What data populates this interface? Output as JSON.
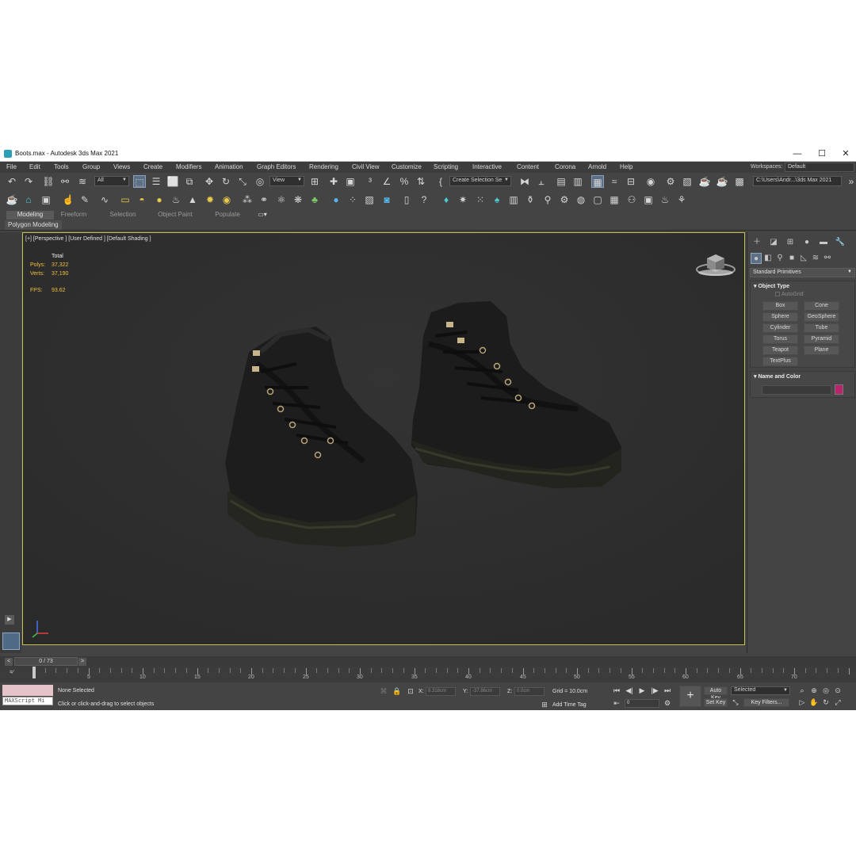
{
  "window": {
    "title": "Boots.max - Autodesk 3ds Max 2021",
    "minimize": "—",
    "maximize": "☐",
    "close": "✕"
  },
  "menu": [
    "File",
    "Edit",
    "Tools",
    "Group",
    "Views",
    "Create",
    "Modifiers",
    "Animation",
    "Graph Editors",
    "Rendering",
    "Civil View",
    "Customize",
    "Scripting",
    "Interactive",
    "Content",
    "Corona",
    "Arnold",
    "Help"
  ],
  "workspaces": {
    "label": "Workspaces:",
    "value": "Default"
  },
  "toolbar": {
    "filter": "All",
    "ref_coord": "View",
    "selection_set": "Create Selection Se",
    "project_path": "C:\\Users\\Andr...\\3ds Max 2021"
  },
  "ribbon": {
    "tabs": [
      "Modeling",
      "Freeform",
      "Selection",
      "Object Paint",
      "Populate"
    ],
    "active_tab": "Modeling",
    "panel": "Polygon Modeling"
  },
  "viewport": {
    "label": "[+] [Perspective ] [User Defined ] [Default Shading ]",
    "stats": {
      "total_label": "Total",
      "polys_label": "Polys:",
      "polys": "37,322",
      "verts_label": "Verts:",
      "verts": "37,190",
      "fps_label": "FPS:",
      "fps": "93.62"
    },
    "colors": {
      "background": "#2e2e2e",
      "border": "#c9c24a",
      "stats": "#f0c040"
    }
  },
  "command_panel": {
    "category": "Standard Primitives",
    "object_type": {
      "header": "Object Type",
      "autogrid": "AutoGrid",
      "buttons": [
        "Box",
        "Cone",
        "Sphere",
        "GeoSphere",
        "Cylinder",
        "Tube",
        "Torus",
        "Pyramid",
        "Teapot",
        "Plane",
        "TextPlus"
      ]
    },
    "name_color": {
      "header": "Name and Color",
      "swatch": "#b8246e"
    }
  },
  "timeline": {
    "frame_counter": "0 / 73",
    "ticks": [
      "5",
      "10",
      "15",
      "20",
      "25",
      "30",
      "35",
      "40",
      "45",
      "50",
      "55",
      "60",
      "65",
      "70"
    ]
  },
  "status": {
    "maxscript": "MAXScript Mi",
    "selection": "None Selected",
    "prompt": "Click or click-and-drag to select objects",
    "x_label": "X:",
    "x_value": "8.318cm",
    "y_label": "Y:",
    "y_value": "-37.86cm",
    "z_label": "Z:",
    "z_value": "0.0cm",
    "grid": "Grid = 10.0cm",
    "add_time_tag": "Add Time Tag",
    "auto_key": "Auto Key",
    "set_key": "Set Key",
    "key_mode": "Selected",
    "key_filters": "Key Filters...",
    "frame_field": "0"
  }
}
